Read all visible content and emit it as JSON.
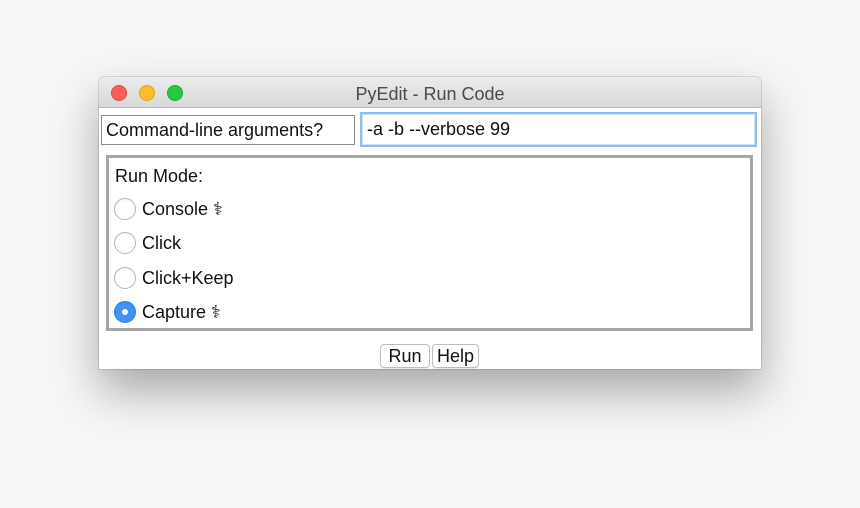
{
  "window": {
    "title": "PyEdit - Run Code"
  },
  "args": {
    "label": "Command-line arguments?",
    "value": "-a -b --verbose 99"
  },
  "run_mode": {
    "title": "Run Mode:",
    "options": [
      {
        "label": "Console ⚕",
        "checked": false
      },
      {
        "label": "Click",
        "checked": false
      },
      {
        "label": "Click+Keep",
        "checked": false
      },
      {
        "label": "Capture ⚕",
        "checked": true
      }
    ]
  },
  "buttons": {
    "run_label": "Run",
    "help_label": "Help"
  },
  "colors": {
    "accent": "#3e93f5",
    "close": "#fc5f57",
    "minimize": "#fdbc2e",
    "maximize": "#28c840"
  }
}
